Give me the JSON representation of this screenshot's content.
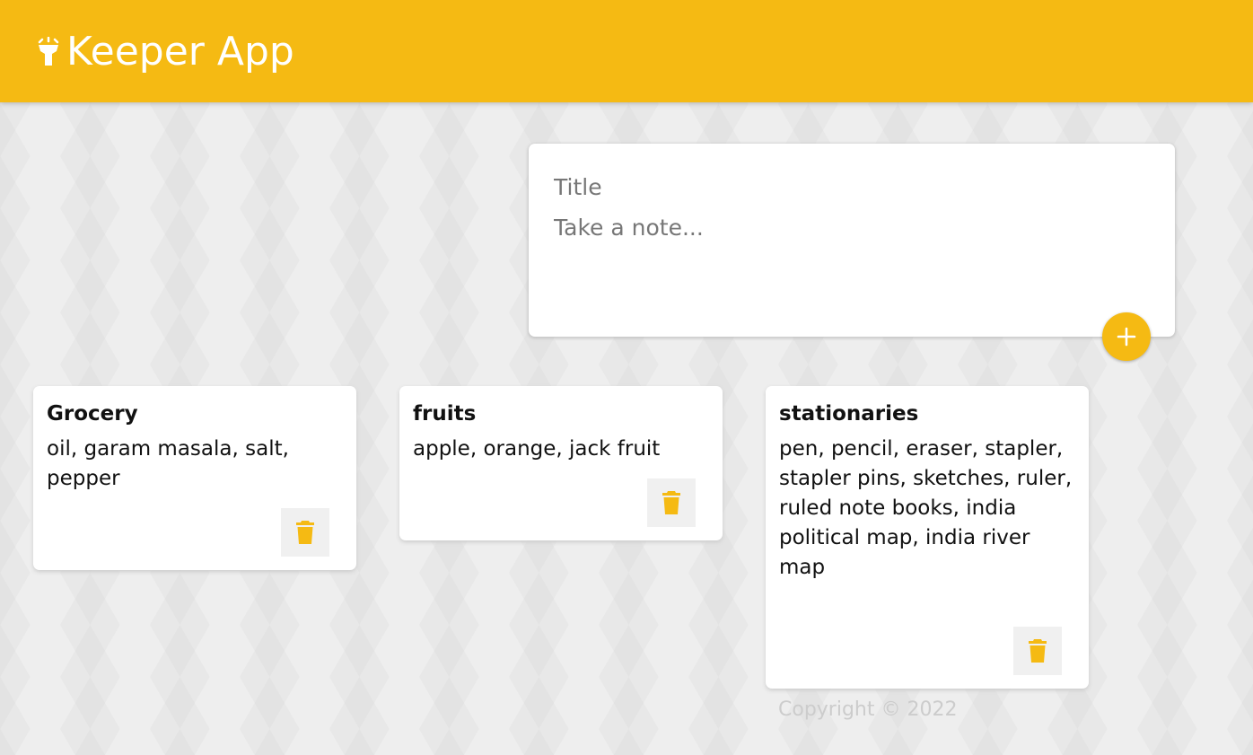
{
  "app": {
    "title": "Keeper App",
    "brand_icon": "flashlight-icon",
    "accent_color": "#f5ba13"
  },
  "create_note": {
    "title_placeholder": "Title",
    "content_placeholder": "Take a note...",
    "title_value": "",
    "content_value": "",
    "add_icon": "plus-icon"
  },
  "notes": [
    {
      "title": "Grocery",
      "content": "oil, garam masala, salt, pepper",
      "delete_icon": "trash-icon"
    },
    {
      "title": "fruits",
      "content": "apple, orange, jack fruit",
      "delete_icon": "trash-icon"
    },
    {
      "title": "stationaries",
      "content": "pen, pencil, eraser, stapler, stapler pins, sketches, ruler, ruled note books, india political map, india river map",
      "delete_icon": "trash-icon"
    }
  ],
  "footer": {
    "copyright": "Copyright © 2022"
  }
}
